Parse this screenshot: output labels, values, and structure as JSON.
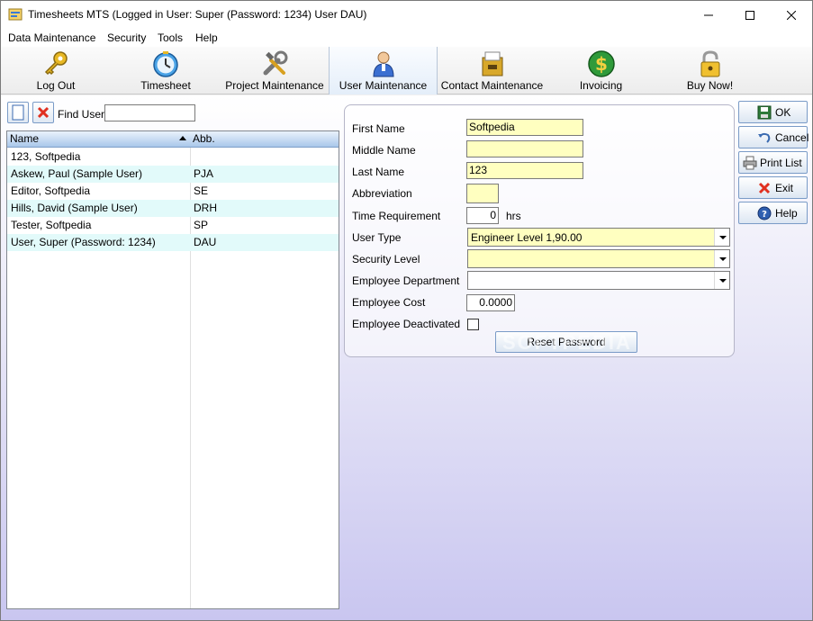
{
  "window": {
    "title": "Timesheets MTS (Logged in User: Super (Password: 1234) User DAU)"
  },
  "menu": [
    "Data Maintenance",
    "Security",
    "Tools",
    "Help"
  ],
  "toolbar": [
    {
      "label": "Log Out",
      "icon": "key-icon"
    },
    {
      "label": "Timesheet",
      "icon": "clock-icon"
    },
    {
      "label": "Project Maintenance",
      "icon": "tools-icon"
    },
    {
      "label": "User Maintenance",
      "icon": "user-icon",
      "active": true
    },
    {
      "label": "Contact Maintenance",
      "icon": "filebox-icon"
    },
    {
      "label": "Invoicing",
      "icon": "dollar-icon"
    },
    {
      "label": "Buy Now!",
      "icon": "lock-icon"
    }
  ],
  "left": {
    "find_label": "Find User:",
    "find_value": "",
    "columns": [
      "Name",
      "Abb."
    ],
    "rows": [
      {
        "name": "123, Softpedia",
        "abb": ""
      },
      {
        "name": "Askew, Paul (Sample User)",
        "abb": "PJA"
      },
      {
        "name": "Editor, Softpedia",
        "abb": "SE"
      },
      {
        "name": "Hills, David (Sample User)",
        "abb": "DRH"
      },
      {
        "name": "Tester, Softpedia",
        "abb": "SP"
      },
      {
        "name": "User, Super (Password: 1234)",
        "abb": "DAU"
      }
    ]
  },
  "form": {
    "first_name_label": "First Name",
    "first_name": "Softpedia",
    "middle_name_label": "Middle Name",
    "middle_name": "",
    "last_name_label": "Last Name",
    "last_name": "123",
    "abbreviation_label": "Abbreviation",
    "abbreviation": "",
    "time_req_label": "Time Requirement",
    "time_req": "0",
    "time_unit": "hrs",
    "user_type_label": "User Type",
    "user_type": "Engineer Level 1,90.00",
    "security_level_label": "Security Level",
    "security_level": "",
    "department_label": "Employee Department",
    "department": "",
    "cost_label": "Employee Cost",
    "cost": "0.0000",
    "deactivated_label": "Employee Deactivated",
    "deactivated": false,
    "reset_password": "Reset Password"
  },
  "buttons": {
    "ok": "OK",
    "cancel": "Cancel",
    "print": "Print List",
    "exit": "Exit",
    "help": "Help"
  },
  "watermark": "SOFTPEDIA",
  "colors": {
    "required_field": "#ffffc0",
    "alt_row": "#e2fafa",
    "header": "#a9c7ea"
  }
}
